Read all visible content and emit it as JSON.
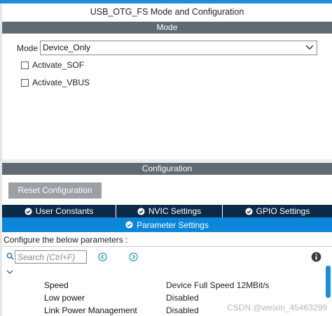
{
  "window": {
    "title": "USB_OTG_FS Mode and Configuration"
  },
  "mode_section": {
    "header": "Mode",
    "mode_label": "Mode",
    "mode_value": "Device_Only",
    "checkboxes": [
      {
        "label": "Activate_SOF",
        "checked": false
      },
      {
        "label": "Activate_VBUS",
        "checked": false
      }
    ]
  },
  "config_section": {
    "header": "Configuration",
    "reset_label": "Reset Configuration",
    "tabs": [
      {
        "label": "User Constants"
      },
      {
        "label": "NVIC Settings"
      },
      {
        "label": "GPIO Settings"
      }
    ],
    "active_tab": "Parameter Settings",
    "configure_text": "Configure the below parameters :",
    "search_placeholder": "Search (Ctrl+F)",
    "parameters": [
      {
        "name": "Speed",
        "value": "Device Full Speed 12MBit/s"
      },
      {
        "name": "Low power",
        "value": "Disabled"
      },
      {
        "name": "Link Power Management",
        "value": "Disabled"
      }
    ]
  },
  "watermark": "CSDN @weixin_45463299",
  "colors": {
    "accent": "#0b86d9",
    "tab_dark": "#0b2a4a",
    "section_header": "#5f6a73",
    "button_gray": "#9ba0a5"
  },
  "icons": [
    "chevron-down-icon",
    "check-circle-icon",
    "search-icon",
    "arrow-left-circle-icon",
    "arrow-right-circle-icon",
    "info-icon",
    "chevron-collapse-icon"
  ]
}
